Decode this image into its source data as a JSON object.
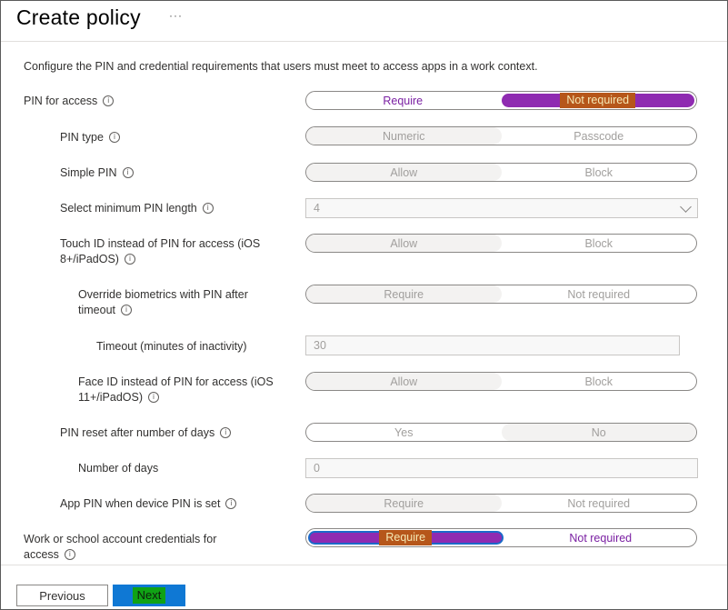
{
  "header": {
    "title": "Create policy",
    "more_label": "···"
  },
  "description": "Configure the PIN and credential requirements that users must meet to access apps in a work context.",
  "info_glyph": "i",
  "settings": {
    "pin_for_access": {
      "label": "PIN for access",
      "left": "Require",
      "right": "Not required",
      "selected": "Not required"
    },
    "pin_type": {
      "label": "PIN type",
      "left": "Numeric",
      "right": "Passcode"
    },
    "simple_pin": {
      "label": "Simple PIN",
      "left": "Allow",
      "right": "Block"
    },
    "min_pin_length": {
      "label": "Select minimum PIN length",
      "value": "4"
    },
    "touch_id": {
      "label_line1": "Touch ID instead of PIN for access (iOS",
      "label_line2": "8+/iPadOS)",
      "left": "Allow",
      "right": "Block"
    },
    "override_biometrics": {
      "label_line1": "Override biometrics with PIN after",
      "label_line2": "timeout",
      "left": "Require",
      "right": "Not required"
    },
    "timeout": {
      "label": "Timeout (minutes of inactivity)",
      "value": "30"
    },
    "face_id": {
      "label_line1": "Face ID instead of PIN for access (iOS",
      "label_line2": "11+/iPadOS)",
      "left": "Allow",
      "right": "Block"
    },
    "pin_reset": {
      "label": "PIN reset after number of days",
      "left": "Yes",
      "right": "No"
    },
    "number_of_days": {
      "label": "Number of days",
      "value": "0"
    },
    "app_pin": {
      "label": "App PIN when device PIN is set",
      "left": "Require",
      "right": "Not required"
    },
    "work_credentials": {
      "label_line1": "Work or school account credentials for",
      "label_line2": "access",
      "left": "Require",
      "right": "Not required",
      "selected": "Require"
    }
  },
  "footer": {
    "previous_label": "Previous",
    "next_label": "Next"
  },
  "colors": {
    "selected_toggle": "#8f2bb1",
    "primary_button": "#0f78d4"
  }
}
